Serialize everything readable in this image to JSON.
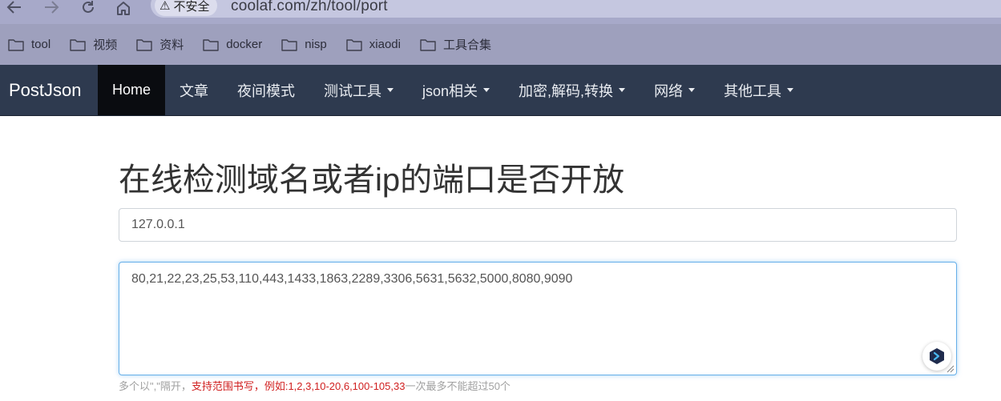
{
  "browser": {
    "security_label": "不安全",
    "url": "coolaf.com/zh/tool/port",
    "bookmarks": [
      "tool",
      "视频",
      "资料",
      "docker",
      "nisp",
      "xiaodi",
      "工具合集"
    ]
  },
  "site": {
    "brand": "PostJson",
    "nav": [
      {
        "label": "Home",
        "active": true,
        "dropdown": false
      },
      {
        "label": "文章",
        "dropdown": false
      },
      {
        "label": "夜间模式",
        "dropdown": false
      },
      {
        "label": "测试工具",
        "dropdown": true
      },
      {
        "label": "json相关",
        "dropdown": true
      },
      {
        "label": "加密,解码,转换",
        "dropdown": true
      },
      {
        "label": "网络",
        "dropdown": true
      },
      {
        "label": "其他工具",
        "dropdown": true
      }
    ]
  },
  "main": {
    "title": "在线检测域名或者ip的端口是否开放",
    "host_value": "127.0.0.1",
    "ports_value": "80,21,22,23,25,53,110,443,1433,1863,2289,3306,5631,5632,5000,8080,9090",
    "help": {
      "part1": "多个以\",\"隔开，",
      "part2": "支持范围书写，例如:1,2,3,10-20,6,100-105,33",
      "part3": "一次最多不能超过50个"
    }
  },
  "colors": {
    "navbar_bg": "#2e3a4f",
    "active_nav_bg": "#0a0c10",
    "focus_border": "#66afe9",
    "help_red": "#d01f1f",
    "chrome_bg": "#a7a9c9"
  },
  "icons": [
    "back-arrow-icon",
    "forward-arrow-icon",
    "reload-icon",
    "home-icon",
    "warning-icon",
    "folder-icon",
    "caret-down-icon",
    "resize-grip-icon",
    "assistant-icon"
  ]
}
